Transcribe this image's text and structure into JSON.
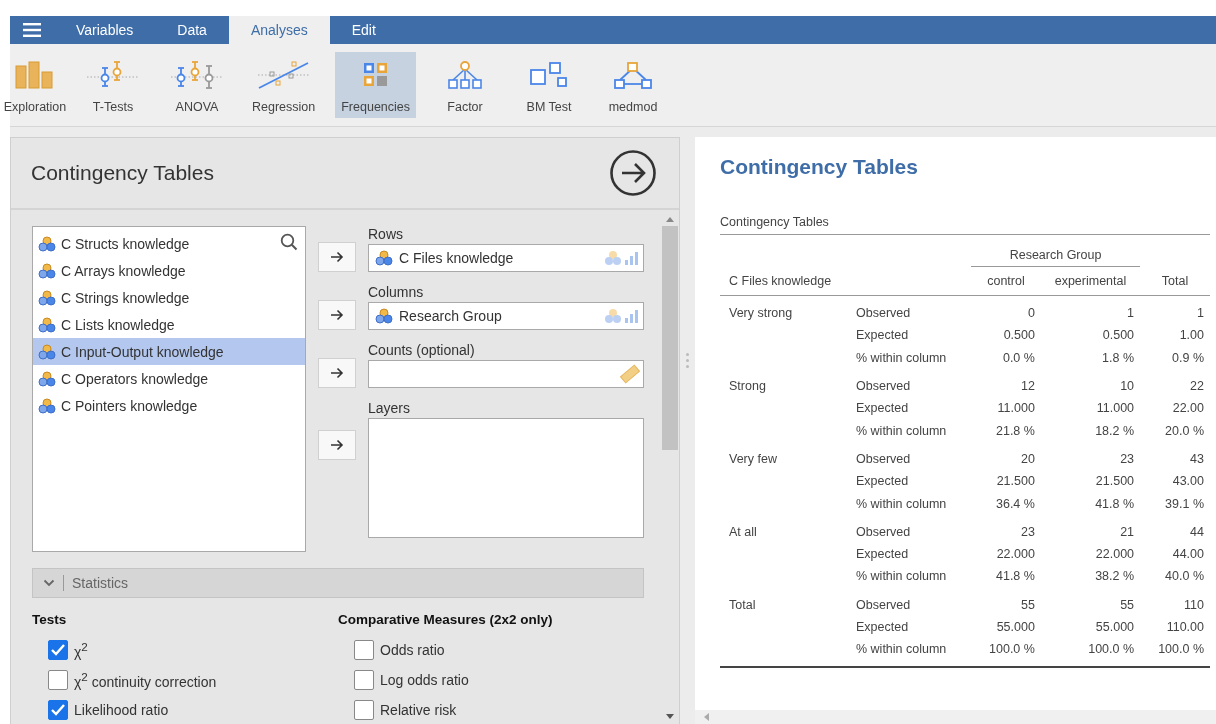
{
  "menu_tabs": [
    {
      "label": "Variables",
      "selected": false
    },
    {
      "label": "Data",
      "selected": false
    },
    {
      "label": "Analyses",
      "selected": true
    },
    {
      "label": "Edit",
      "selected": false
    }
  ],
  "toolbar": [
    {
      "label": "Exploration",
      "selected": false
    },
    {
      "label": "T-Tests",
      "selected": false
    },
    {
      "label": "ANOVA",
      "selected": false
    },
    {
      "label": "Regression",
      "selected": false
    },
    {
      "label": "Frequencies",
      "selected": true
    },
    {
      "label": "Factor",
      "selected": false
    },
    {
      "label": "BM Test",
      "selected": false
    },
    {
      "label": "medmod",
      "selected": false
    }
  ],
  "options_panel": {
    "title": "Contingency Tables",
    "variables": [
      {
        "name": "C Structs knowledge",
        "selected": false
      },
      {
        "name": "C Arrays knowledge",
        "selected": false
      },
      {
        "name": "C Strings knowledge",
        "selected": false
      },
      {
        "name": "C Lists knowledge",
        "selected": false
      },
      {
        "name": "C Input-Output knowledge",
        "selected": true
      },
      {
        "name": "C Operators knowledge",
        "selected": false
      },
      {
        "name": "C Pointers knowledge",
        "selected": false
      }
    ],
    "targets": [
      {
        "label": "Rows",
        "kind": "variable",
        "value": "C Files knowledge"
      },
      {
        "label": "Columns",
        "kind": "variable",
        "value": "Research Group"
      },
      {
        "label": "Counts (optional)",
        "kind": "count"
      },
      {
        "label": "Layers",
        "kind": "list"
      }
    ],
    "section": {
      "label": "Statistics",
      "expanded": true
    },
    "groups": [
      {
        "heading": "Tests",
        "options": [
          {
            "label": "χ$^{2}$",
            "checked": true
          },
          {
            "label": "χ$^{2}$ continuity correction",
            "checked": false
          },
          {
            "label": "Likelihood ratio",
            "checked": true
          }
        ]
      },
      {
        "heading": "Comparative Measures (2x2 only)",
        "options": [
          {
            "label": "Odds ratio",
            "checked": false
          },
          {
            "label": "Log odds ratio",
            "checked": false
          },
          {
            "label": "Relative risk",
            "checked": false
          }
        ]
      }
    ]
  },
  "results": {
    "title": "Contingency Tables",
    "table_title": "Contingency Tables",
    "column_group": "Research Group",
    "row_variable": "C Files knowledge",
    "columns": [
      "control",
      "experimental",
      "Total"
    ],
    "row_groups": [
      {
        "label": "Very strong",
        "rows": [
          {
            "stat": "Observed",
            "values": [
              "0",
              "1",
              "1"
            ]
          },
          {
            "stat": "Expected",
            "values": [
              "0.500",
              "0.500",
              "1.00"
            ]
          },
          {
            "stat": "% within column",
            "values": [
              "0.0 %",
              "1.8 %",
              "0.9 %"
            ]
          }
        ]
      },
      {
        "label": "Strong",
        "rows": [
          {
            "stat": "Observed",
            "values": [
              "12",
              "10",
              "22"
            ]
          },
          {
            "stat": "Expected",
            "values": [
              "11.000",
              "11.000",
              "22.00"
            ]
          },
          {
            "stat": "% within column",
            "values": [
              "21.8 %",
              "18.2 %",
              "20.0 %"
            ]
          }
        ]
      },
      {
        "label": "Very few",
        "rows": [
          {
            "stat": "Observed",
            "values": [
              "20",
              "23",
              "43"
            ]
          },
          {
            "stat": "Expected",
            "values": [
              "21.500",
              "21.500",
              "43.00"
            ]
          },
          {
            "stat": "% within column",
            "values": [
              "36.4 %",
              "41.8 %",
              "39.1 %"
            ]
          }
        ]
      },
      {
        "label": "At all",
        "rows": [
          {
            "stat": "Observed",
            "values": [
              "23",
              "21",
              "44"
            ]
          },
          {
            "stat": "Expected",
            "values": [
              "22.000",
              "22.000",
              "44.00"
            ]
          },
          {
            "stat": "% within column",
            "values": [
              "41.8 %",
              "38.2 %",
              "40.0 %"
            ]
          }
        ]
      },
      {
        "label": "Total",
        "rows": [
          {
            "stat": "Observed",
            "values": [
              "55",
              "55",
              "110"
            ]
          },
          {
            "stat": "Expected",
            "values": [
              "55.000",
              "55.000",
              "110.00"
            ]
          },
          {
            "stat": "% within column",
            "values": [
              "100.0 %",
              "100.0 %",
              "100.0 %"
            ]
          }
        ]
      }
    ]
  }
}
